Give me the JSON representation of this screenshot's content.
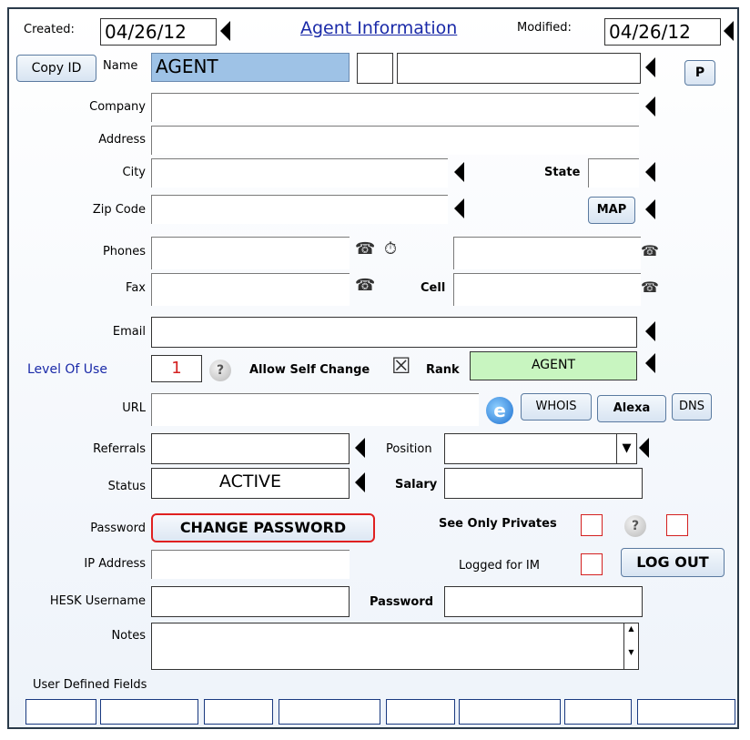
{
  "header": {
    "created_label": "Created:",
    "created_value": "04/26/12",
    "title": "Agent Information",
    "modified_label": "Modified:",
    "modified_value": "04/26/12"
  },
  "name_row": {
    "copy_id": "Copy ID",
    "label": "Name",
    "first_name": "AGENT",
    "middle": "",
    "last_name": "",
    "p_button": "P"
  },
  "labels": {
    "company": "Company",
    "address": "Address",
    "city": "City",
    "state": "State",
    "zip": "Zip Code",
    "map": "MAP",
    "phones": "Phones",
    "fax": "Fax",
    "cell": "Cell",
    "email": "Email",
    "level_of_use": "Level Of Use",
    "allow_self_change": "Allow Self Change",
    "rank": "Rank",
    "url": "URL",
    "referrals": "Referrals",
    "position": "Position",
    "status": "Status",
    "salary": "Salary",
    "password": "Password",
    "see_only_privates": "See Only Privates",
    "ip_address": "IP Address",
    "logged_for_im": "Logged for IM",
    "hesk_username": "HESK Username",
    "hesk_password": "Password",
    "notes": "Notes",
    "user_defined_fields": "User Defined Fields"
  },
  "values": {
    "level_of_use": "1",
    "rank": "AGENT",
    "status": "ACTIVE",
    "allow_self_change_mark": "☒"
  },
  "buttons": {
    "whois": "WHOIS",
    "alexa": "Alexa",
    "dns": "DNS",
    "change_password": "CHANGE PASSWORD",
    "log_out": "LOG OUT",
    "help": "?"
  },
  "icons": {
    "phone": "☎",
    "timer": "⏱",
    "position_dropdown": "▼",
    "scroll_up": "▲",
    "scroll_down": "▼"
  },
  "colors": {
    "title_blue": "#1a2aa8",
    "name_field_bg": "#9ec2e6",
    "rank_bg": "#c8f5c0",
    "checkbox_red": "#d42020",
    "change_password_border": "#e02020"
  }
}
